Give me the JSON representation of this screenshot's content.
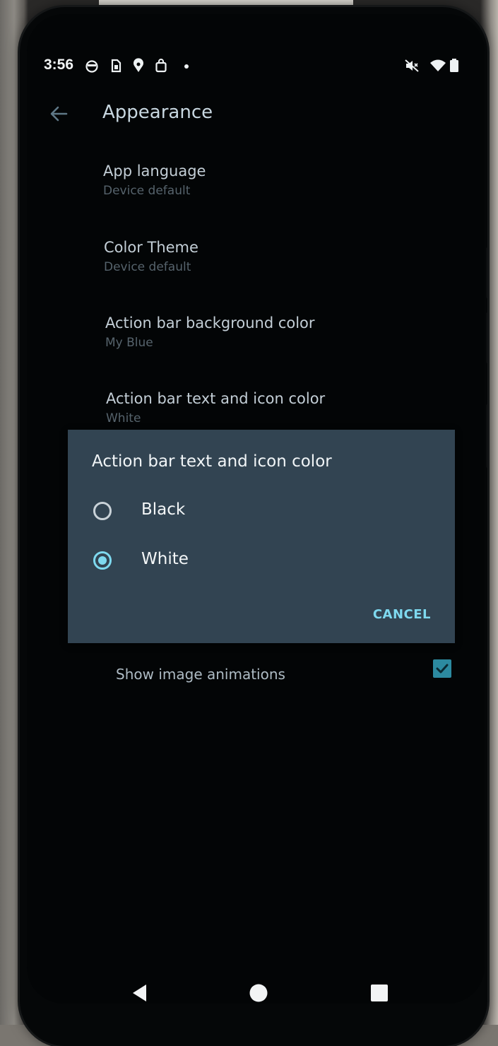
{
  "status_bar": {
    "time": "3:56",
    "left_icons": [
      "alarm-icon",
      "sim-card-icon",
      "location-icon",
      "shopping-bag-icon",
      "notification-dot-icon"
    ],
    "right_icons": [
      "mute-icon",
      "wifi-icon",
      "battery-icon"
    ]
  },
  "app_bar": {
    "title": "Appearance",
    "back_icon": "arrow-left-icon"
  },
  "preferences": [
    {
      "title": "App language",
      "summary": "Device default"
    },
    {
      "title": "Color Theme",
      "summary": "Device default"
    },
    {
      "title": "Action bar background color",
      "summary": "My Blue"
    },
    {
      "title": "Action bar text and icon color",
      "summary": "White"
    }
  ],
  "dialog": {
    "title": "Action bar text and icon color",
    "options": [
      {
        "label": "Black",
        "selected": false
      },
      {
        "label": "White",
        "selected": true
      }
    ],
    "cancel_label": "CANCEL"
  },
  "image_animations": {
    "label": "Show image animations",
    "checked": true
  },
  "nav_bar": {
    "icons": [
      "back-triangle-icon",
      "home-circle-icon",
      "recents-square-icon"
    ]
  },
  "colors": {
    "accent": "#7ed9ef",
    "dialog_bg": "#324452",
    "screen_bg": "#030506"
  }
}
